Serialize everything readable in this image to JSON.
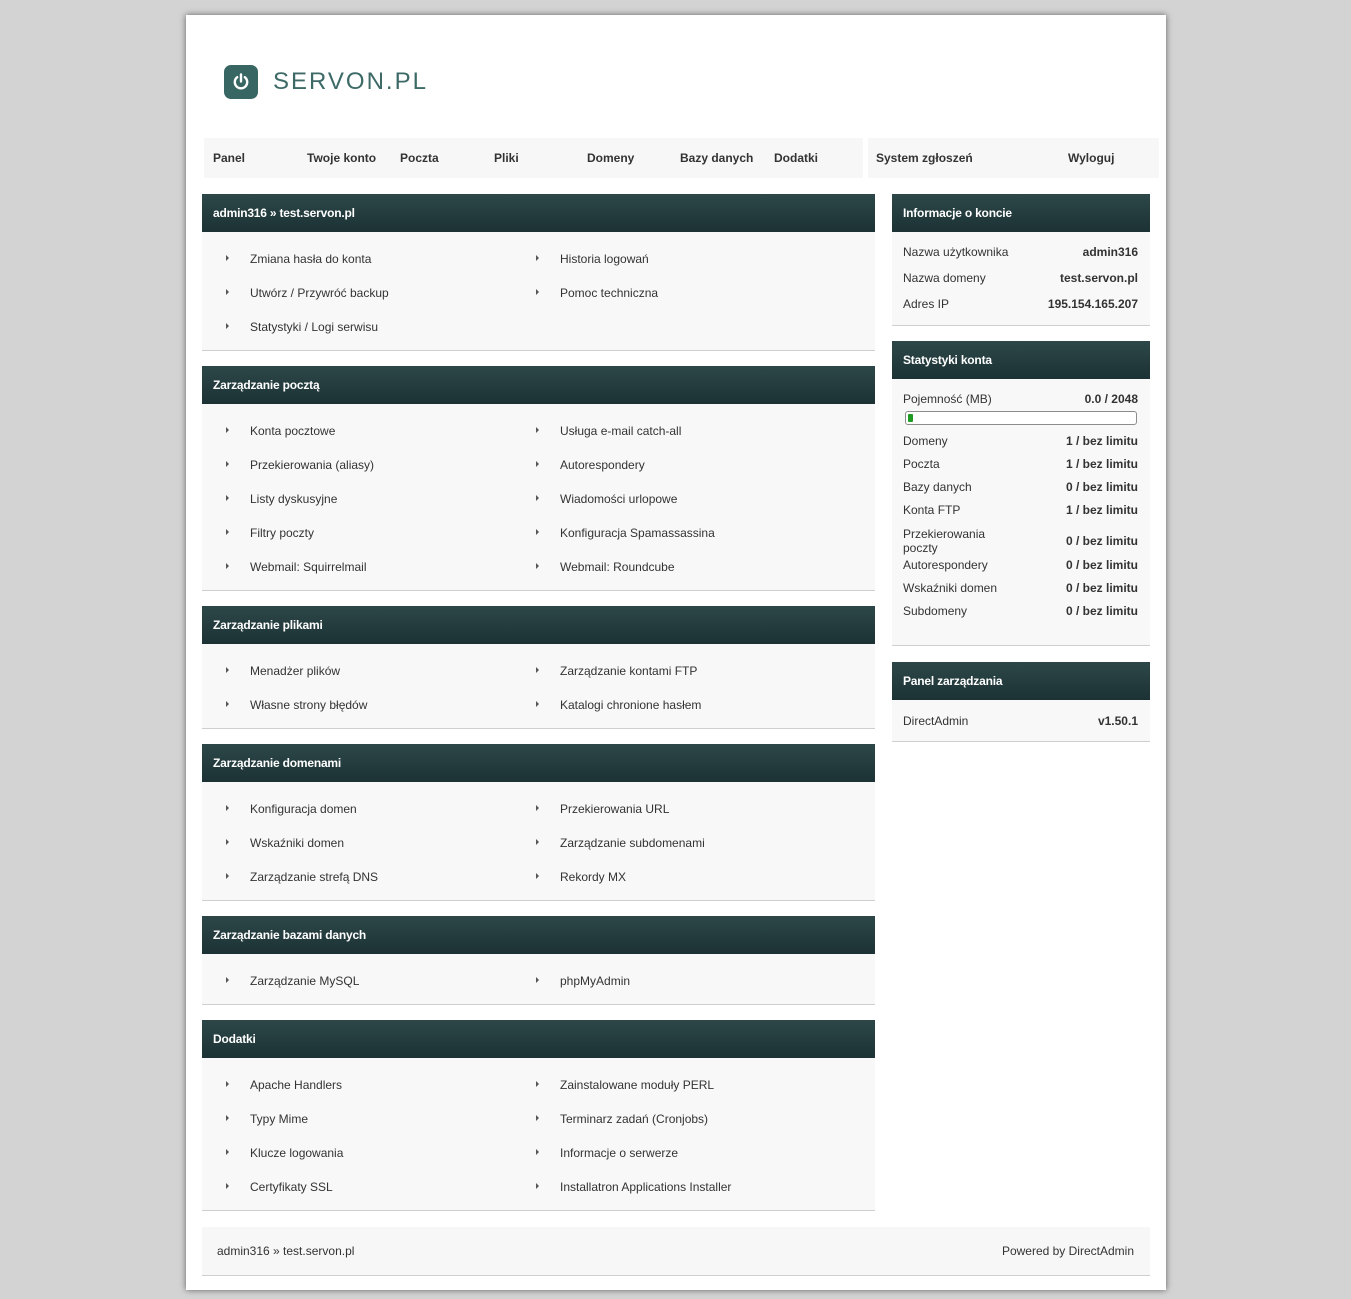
{
  "brand": {
    "name": "SERVON.PL",
    "icon": "power-icon",
    "color": "#386663"
  },
  "nav": {
    "main": [
      "Panel",
      "Twoje konto",
      "Poczta",
      "Pliki",
      "Domeny",
      "Bazy danych",
      "Dodatki"
    ],
    "side": [
      "System zgłoszeń",
      "Wyloguj"
    ]
  },
  "sections": [
    {
      "title": "admin316 » test.servon.pl",
      "left": [
        "Zmiana hasła do konta",
        "Utwórz / Przywróć backup",
        "Statystyki / Logi serwisu"
      ],
      "right": [
        "Historia logowań",
        "Pomoc techniczna"
      ]
    },
    {
      "title": "Zarządzanie pocztą",
      "left": [
        "Konta pocztowe",
        "Przekierowania (aliasy)",
        "Listy dyskusyjne",
        "Filtry poczty",
        "Webmail: Squirrelmail"
      ],
      "right": [
        "Usługa e-mail catch-all",
        "Autorespondery",
        "Wiadomości urlopowe",
        "Konfiguracja Spamassassina",
        "Webmail: Roundcube"
      ]
    },
    {
      "title": "Zarządzanie plikami",
      "left": [
        "Menadżer plików",
        "Własne strony błędów"
      ],
      "right": [
        "Zarządzanie kontami FTP",
        "Katalogi chronione hasłem"
      ]
    },
    {
      "title": "Zarządzanie domenami",
      "left": [
        "Konfiguracja domen",
        "Wskaźniki domen",
        "Zarządzanie strefą DNS"
      ],
      "right": [
        "Przekierowania URL",
        "Zarządzanie subdomenami",
        "Rekordy MX"
      ]
    },
    {
      "title": "Zarządzanie bazami danych",
      "left": [
        "Zarządzanie MySQL"
      ],
      "right": [
        "phpMyAdmin"
      ]
    },
    {
      "title": "Dodatki",
      "left": [
        "Apache Handlers",
        "Typy Mime",
        "Klucze logowania",
        "Certyfikaty SSL"
      ],
      "right": [
        "Zainstalowane moduły PERL",
        "Terminarz zadań (Cronjobs)",
        "Informacje o serwerze",
        "Installatron Applications Installer"
      ]
    }
  ],
  "account_info": {
    "title": "Informacje o koncie",
    "rows": [
      {
        "label": "Nazwa użytkownika",
        "value": "admin316"
      },
      {
        "label": "Nazwa domeny",
        "value": "test.servon.pl"
      },
      {
        "label": "Adres IP",
        "value": "195.154.165.207"
      }
    ]
  },
  "stats": {
    "title": "Statystyki konta",
    "capacity_label": "Pojemność (MB)",
    "capacity_value": "0.0 / 2048",
    "capacity_fraction": 0.02,
    "rows": [
      {
        "label": "Domeny",
        "value": "1 / bez limitu"
      },
      {
        "label": "Poczta",
        "value": "1 / bez limitu"
      },
      {
        "label": "Bazy danych",
        "value": "0 / bez limitu"
      },
      {
        "label": "Konta FTP",
        "value": "1 / bez limitu"
      },
      {
        "label": "Przekierowania poczty",
        "value": "0 / bez limitu"
      },
      {
        "label": "Autorespondery",
        "value": "0 / bez limitu"
      },
      {
        "label": "Wskaźniki domen",
        "value": "0 / bez limitu"
      },
      {
        "label": "Subdomeny",
        "value": "0 / bez limitu"
      }
    ]
  },
  "panel": {
    "title": "Panel zarządzania",
    "rows": [
      {
        "label": "DirectAdmin",
        "value": "v1.50.1"
      }
    ]
  },
  "footer": {
    "left": "admin316 » test.servon.pl",
    "right": "Powered by DirectAdmin"
  }
}
